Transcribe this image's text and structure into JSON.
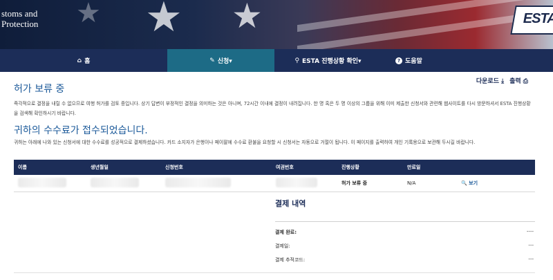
{
  "header": {
    "agency_line1": "stoms and",
    "agency_line2": "Protection",
    "logo_text": "ESTA"
  },
  "nav": {
    "items": [
      {
        "icon": "home-icon",
        "glyph": "⌂",
        "label": "홈"
      },
      {
        "icon": "pencil-icon",
        "glyph": "✎",
        "label": "신청▾",
        "active": true
      },
      {
        "icon": "search-icon",
        "glyph": "⚲",
        "label": "ESTA 진행상황 확인▾"
      },
      {
        "icon": "help-icon",
        "glyph": "?",
        "label": "도움말"
      }
    ]
  },
  "toolbar": {
    "download_label": "다운로드 ⤓",
    "print_label": "출력 ⎙"
  },
  "main": {
    "title1": "허가 보류 중",
    "paragraph1": "즉각적으로 결정을 내릴 수 없으므로 여행 허가를 검토 중입니다. 상기 답변이 부정적인 결정을 의미하는 것은 아니며, 72시간 이내에 결정이 내려집니다. 한 명 혹은 두 명 이상의 그룹을 위해 이미 제출한 신청서와 관련해 웹사이트를 다시 방문하셔서 ESTA 진행상황을 검색해 확인하시기 바랍니다.",
    "title2": "귀하의 수수료가 접수되었습니다.",
    "paragraph2": "귀하는 아래에 나와 있는 신청서에 대한 수수료를 성공적으로 결제하셨습니다. 카드 소지자가 은행이나 페이팔에 수수료 환불을 요청할 시 신청서는 자동으로 거절이 됩니다. 이 페이지를 출력하여 개인 기록용으로 보관해 두시길 바랍니다."
  },
  "table": {
    "headers": [
      "이름",
      "생년월일",
      "신청번호",
      "여권번호",
      "진행상황",
      "만료일",
      ""
    ],
    "rows": [
      {
        "status": "허가 보류 중",
        "expiry": "N/A",
        "action": "🔍 보기"
      }
    ]
  },
  "payment": {
    "title": "결제 내역",
    "rows": [
      {
        "label": "결제 완료:",
        "value": "----"
      },
      {
        "label": "결제일:",
        "value": "---"
      },
      {
        "label": "결제 추적코드:",
        "value": "---"
      }
    ]
  },
  "colors": {
    "nav_bg": "#1c2d58",
    "nav_active": "#1d6b86",
    "heading": "#1c5a9a"
  }
}
